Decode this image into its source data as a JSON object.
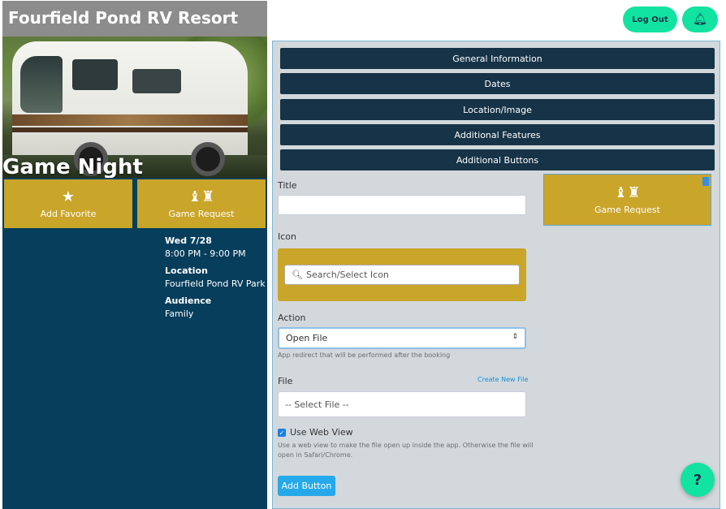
{
  "resort": {
    "name": "Fourfield Pond RV Resort"
  },
  "event": {
    "title": "Game Night",
    "date": "Wed 7/28",
    "time": "8:00 PM - 9:00 PM",
    "location_label": "Location",
    "location": "Fourfield Pond RV Park",
    "audience_label": "Audience",
    "audience": "Family"
  },
  "tiles": [
    {
      "label": "Add Favorite",
      "icon": "star-icon"
    },
    {
      "label": "Game Request",
      "icon": "chess-icon"
    }
  ],
  "header": {
    "logout_label": "Log Out",
    "bell_icon": "bell-icon"
  },
  "accordion": [
    "General Information",
    "Dates",
    "Location/Image",
    "Additional Features",
    "Additional Buttons"
  ],
  "form": {
    "title_label": "Title",
    "title_value": "",
    "icon_label": "Icon",
    "icon_search_placeholder": "Search/Select Icon",
    "action_label": "Action",
    "action_value": "Open File",
    "action_help": "App redirect that will be performed after the booking",
    "file_label": "File",
    "create_file_link": "Create New File",
    "file_value": "-- Select File --",
    "webview_label": "Use Web View",
    "webview_checked": true,
    "webview_help_line1": "Use a web view to make the file open up inside the app. Otherwise the file will",
    "webview_help_line2": "open in Safari/Chrome.",
    "add_button_label": "Add Button"
  },
  "preview": {
    "label": "Game Request",
    "icon": "chess-icon"
  },
  "help_fab": "?",
  "colors": {
    "navy": "#163347",
    "teal_dark": "#063e5c",
    "gold": "#c9a52a",
    "mint": "#12e3a1",
    "blue": "#26a9ea"
  }
}
